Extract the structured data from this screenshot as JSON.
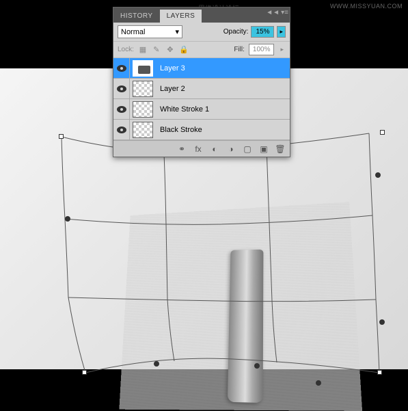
{
  "watermark": "WWW.MISSYUAN.COM",
  "forum_text": "思缘设计论坛",
  "panel": {
    "tabs": {
      "history": "HISTORY",
      "layers": "LAYERS"
    },
    "blend_mode": "Normal",
    "opacity_label": "Opacity:",
    "opacity_value": "15%",
    "lock_label": "Lock:",
    "fill_label": "Fill:",
    "fill_value": "100%",
    "layers": [
      {
        "name": "Layer 3",
        "selected": true,
        "visible": true,
        "checker": false
      },
      {
        "name": "Layer 2",
        "selected": false,
        "visible": true,
        "checker": true
      },
      {
        "name": "White Stroke 1",
        "selected": false,
        "visible": true,
        "checker": true
      },
      {
        "name": "Black Stroke",
        "selected": false,
        "visible": true,
        "checker": true
      }
    ],
    "bottom_icons": {
      "link": "⚭",
      "fx": "fx",
      "mask": "◐",
      "adjust": "◑",
      "folder": "▢",
      "new": "▣",
      "trash": "🗑"
    }
  }
}
